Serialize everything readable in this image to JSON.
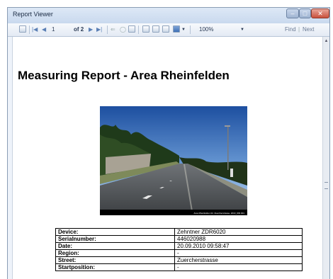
{
  "window": {
    "title": "Report Viewer"
  },
  "toolbar": {
    "page_current": "1",
    "page_of": "of 2",
    "zoom": "100%",
    "find_label": "Find",
    "next_label": "Next"
  },
  "report": {
    "title": "Measuring Report - Area Rheinfelden",
    "photo_caption": "Area Rheinfelden 02, Zuercherstrasse, 2010_009 001",
    "rows": [
      {
        "label": "Device:",
        "value": "Zehntner ZDR6020"
      },
      {
        "label": "Serialnumber:",
        "value": "446020988"
      },
      {
        "label": "Date:",
        "value": "20.09.2010 09:58:47"
      },
      {
        "label": "Region:",
        "value": "-"
      },
      {
        "label": "Street:",
        "value": "Zuercherstrasse"
      },
      {
        "label": "Startposition:",
        "value": "-"
      }
    ]
  }
}
